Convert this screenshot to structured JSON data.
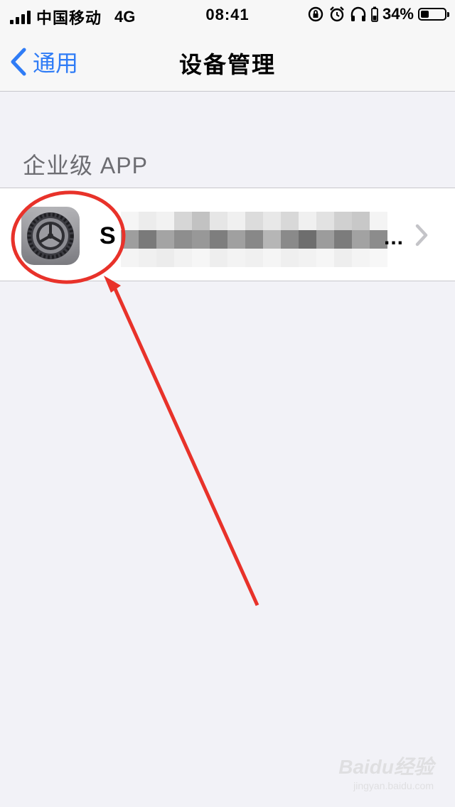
{
  "status_bar": {
    "carrier": "中国移动",
    "network": "4G",
    "time": "08:41",
    "battery_percent": "34%",
    "battery_level": 0.34,
    "icons": [
      "signal-icon",
      "orientation-lock-icon",
      "alarm-icon",
      "headphones-icon",
      "battery-icon"
    ]
  },
  "nav": {
    "back_label": "通用",
    "title": "设备管理"
  },
  "section": {
    "header": "企业级 APP"
  },
  "profile_row": {
    "title_visible": "S",
    "ellipsis": "...",
    "icon": "settings-gear-icon"
  },
  "watermark": {
    "brand": "Baidu经验",
    "sub": "jingyan.baidu.com"
  },
  "colors": {
    "accent": "#2f7cf6",
    "background": "#f2f2f7",
    "annotation": "#e8322a"
  }
}
